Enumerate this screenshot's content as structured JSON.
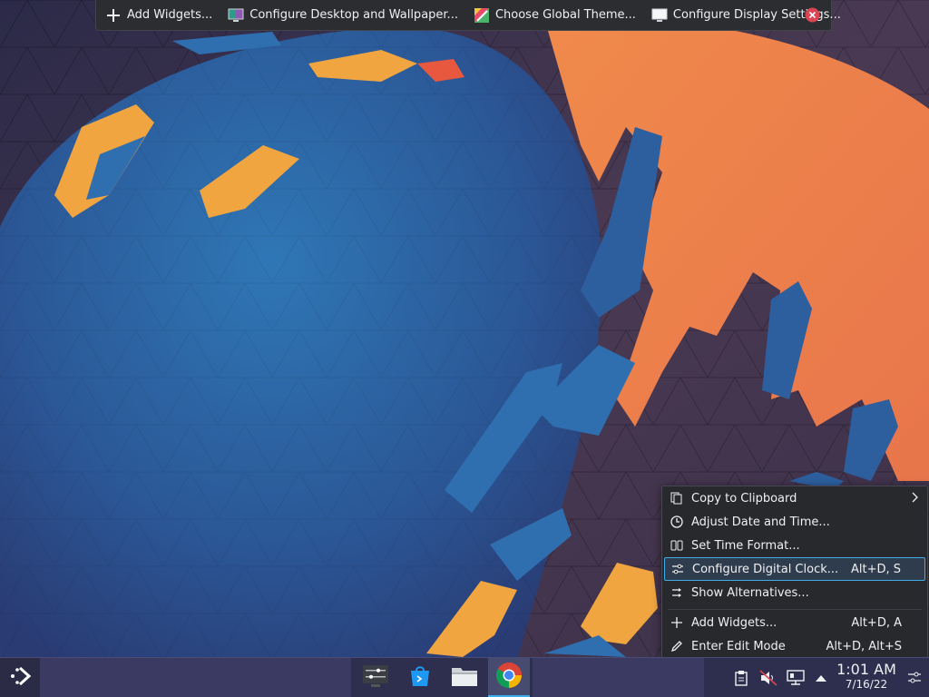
{
  "toolbar": {
    "add_widgets": "Add Widgets...",
    "configure_desktop": "Configure Desktop and Wallpaper...",
    "global_theme": "Choose Global Theme...",
    "display_settings": "Configure Display Settings..."
  },
  "context_menu": {
    "items": [
      {
        "label": "Copy to Clipboard",
        "shortcut": "",
        "icon": "copy-icon",
        "has_submenu": true
      },
      {
        "label": "Adjust Date and Time...",
        "shortcut": "",
        "icon": "clock-icon"
      },
      {
        "label": "Set Time Format...",
        "shortcut": "",
        "icon": "time-format-icon"
      },
      {
        "label": "Configure Digital Clock...",
        "shortcut": "Alt+D, S",
        "icon": "configure-icon",
        "highlighted": true
      },
      {
        "label": "Show Alternatives...",
        "shortcut": "",
        "icon": "alternatives-icon"
      },
      {
        "label": "Add Widgets...",
        "shortcut": "Alt+D, A",
        "icon": "plus-icon"
      },
      {
        "label": "Enter Edit Mode",
        "shortcut": "Alt+D, Alt+S",
        "icon": "pencil-icon"
      }
    ]
  },
  "taskbar": {
    "tasks": [
      {
        "name": "system-settings",
        "icon": "system-settings-icon"
      },
      {
        "name": "discover",
        "icon": "discover-store-icon"
      },
      {
        "name": "dolphin",
        "icon": "folder-icon"
      },
      {
        "name": "chrome",
        "icon": "chrome-icon",
        "active": true
      }
    ],
    "tray": [
      "clipboard-icon",
      "volume-muted-icon",
      "network-icon",
      "expand-arrow-icon"
    ],
    "clock": {
      "time": "1:01 AM",
      "date": "7/16/22"
    }
  },
  "colors": {
    "accent": "#3daee9",
    "menu_bg": "#27292d",
    "panel_bg": "#3a3a62",
    "wallpaper_blue": "#2f6fb0",
    "wallpaper_orange": "#f08a4b"
  }
}
